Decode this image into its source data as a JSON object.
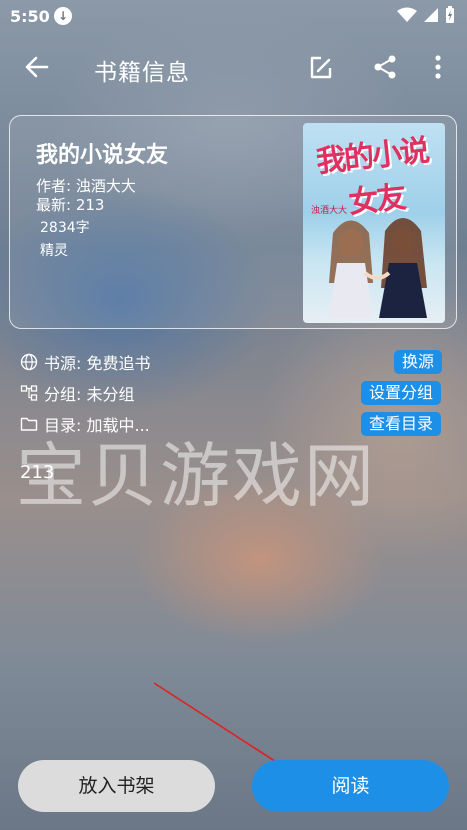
{
  "status": {
    "time": "5:50"
  },
  "header": {
    "title": "书籍信息"
  },
  "book": {
    "title": "我的小说女友",
    "author": "作者: 浊酒大大",
    "latest": "最新: 213",
    "words": "2834字",
    "category": "精灵",
    "cover_title": "我的小说女友",
    "cover_author": "浊酒大大"
  },
  "info": {
    "source_label": "书源: 免费追书",
    "source_action": "换源",
    "group_label": "分组: 未分组",
    "group_action": "设置分组",
    "toc_label": "目录: 加载中...",
    "toc_action": "查看目录"
  },
  "chapter": "213",
  "watermark": "宝贝游戏网",
  "buttons": {
    "shelf": "放入书架",
    "read": "阅读"
  },
  "colors": {
    "accent": "#1e8fe6",
    "shelf_button": "#dcdcdc",
    "arrow": "#e02020"
  }
}
